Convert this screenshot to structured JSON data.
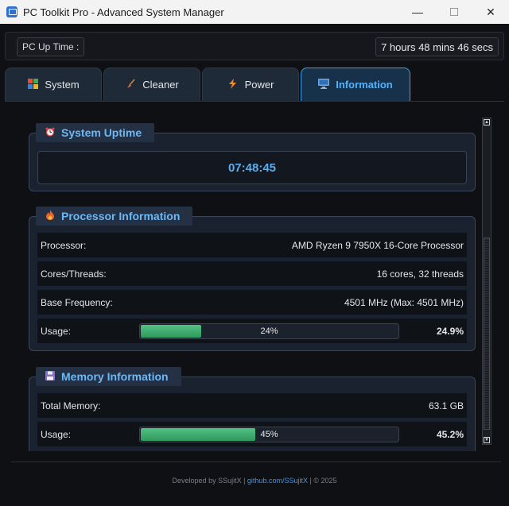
{
  "window": {
    "title": "PC Toolkit Pro - Advanced System Manager",
    "minimize": "—",
    "close": "✕"
  },
  "uptime_bar": {
    "label": "PC Up Time :",
    "value": "7 hours 48 mins 46 secs"
  },
  "tabs": [
    {
      "label": "System",
      "icon": "system-icon"
    },
    {
      "label": "Cleaner",
      "icon": "broom-icon"
    },
    {
      "label": "Power",
      "icon": "lightning-icon"
    },
    {
      "label": "Information",
      "icon": "monitor-icon",
      "active": true
    }
  ],
  "system_uptime": {
    "title": "System Uptime",
    "icon": "alarm-clock-icon",
    "clock": "07:48:45"
  },
  "processor": {
    "title": "Processor Information",
    "icon": "fire-icon",
    "rows": [
      {
        "label": "Processor:",
        "value": "AMD Ryzen 9 7950X 16-Core Processor"
      },
      {
        "label": "Cores/Threads:",
        "value": "16 cores, 32 threads"
      },
      {
        "label": "Base Frequency:",
        "value": "4501 MHz (Max: 4501 MHz)"
      }
    ],
    "usage_label": "Usage:",
    "usage_bar_text": "24%",
    "usage_percent": 24,
    "usage_value": "24.9%"
  },
  "memory": {
    "title": "Memory Information",
    "icon": "floppy-disk-icon",
    "rows": [
      {
        "label": "Total Memory:",
        "value": "63.1 GB"
      }
    ],
    "usage_label": "Usage:",
    "usage_bar_text": "45%",
    "usage_percent": 45,
    "usage_value": "45.2%"
  },
  "footer": {
    "prefix": "Developed by SSujitX | ",
    "link": "github.com/SSujitX",
    "suffix": " | © 2025"
  },
  "colors": {
    "accent": "#4fb4ff",
    "progress_green": "#3fae70",
    "group_title": "#6cb8f5"
  }
}
